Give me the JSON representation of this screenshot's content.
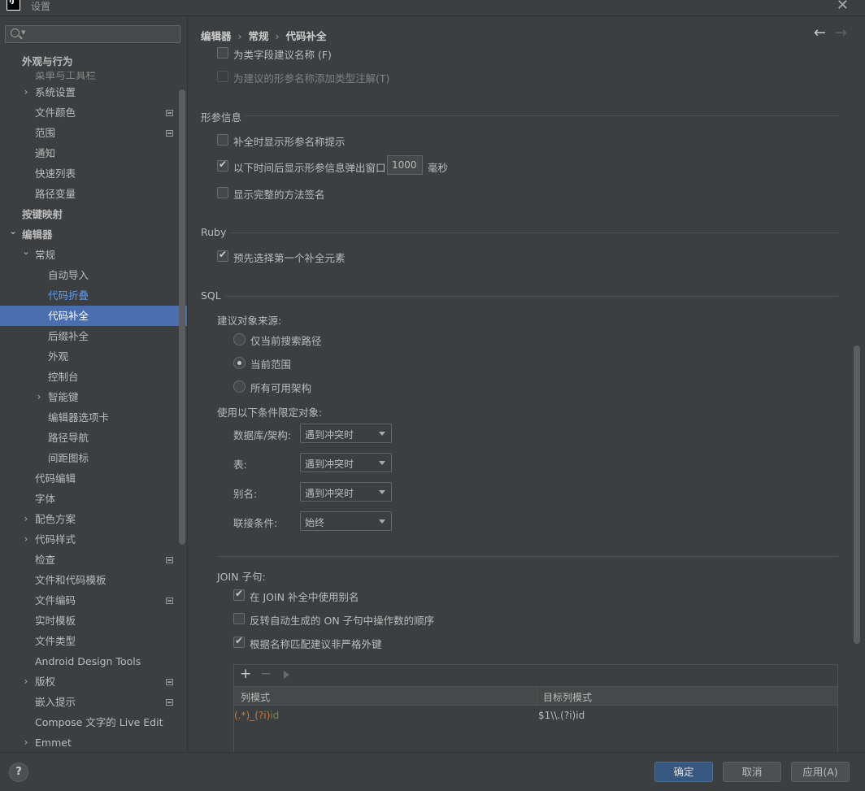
{
  "window": {
    "title": "设置",
    "app_icon": "IJ"
  },
  "search": {
    "placeholder": ""
  },
  "sidebar": {
    "items": [
      {
        "label": "外观与行为",
        "level": 0,
        "bold": true
      },
      {
        "label": "菜单与工具栏",
        "level": 1,
        "cut": true
      },
      {
        "label": "系统设置",
        "level": 1,
        "expandable": true
      },
      {
        "label": "文件颜色",
        "level": 1,
        "badge": true
      },
      {
        "label": "范围",
        "level": 1,
        "badge": true
      },
      {
        "label": "通知",
        "level": 1
      },
      {
        "label": "快速列表",
        "level": 1
      },
      {
        "label": "路径变量",
        "level": 1
      },
      {
        "label": "按键映射",
        "level": 0,
        "bold": true
      },
      {
        "label": "编辑器",
        "level": 0,
        "bold": true,
        "expanded": true
      },
      {
        "label": "常规",
        "level": 1,
        "expanded": true
      },
      {
        "label": "自动导入",
        "level": 2
      },
      {
        "label": "代码折叠",
        "level": 2,
        "link": true
      },
      {
        "label": "代码补全",
        "level": 2,
        "selected": true
      },
      {
        "label": "后缀补全",
        "level": 2
      },
      {
        "label": "外观",
        "level": 2
      },
      {
        "label": "控制台",
        "level": 2
      },
      {
        "label": "智能键",
        "level": 2,
        "expandable": true
      },
      {
        "label": "编辑器选项卡",
        "level": 2
      },
      {
        "label": "路径导航",
        "level": 2
      },
      {
        "label": "间距图标",
        "level": 2
      },
      {
        "label": "代码编辑",
        "level": 1
      },
      {
        "label": "字体",
        "level": 1
      },
      {
        "label": "配色方案",
        "level": 1,
        "expandable": true
      },
      {
        "label": "代码样式",
        "level": 1,
        "expandable": true
      },
      {
        "label": "检查",
        "level": 1,
        "badge": true
      },
      {
        "label": "文件和代码模板",
        "level": 1
      },
      {
        "label": "文件编码",
        "level": 1,
        "badge": true
      },
      {
        "label": "实时模板",
        "level": 1
      },
      {
        "label": "文件类型",
        "level": 1
      },
      {
        "label": "Android Design Tools",
        "level": 1
      },
      {
        "label": "版权",
        "level": 1,
        "expandable": true,
        "badge": true
      },
      {
        "label": "嵌入提示",
        "level": 1,
        "badge": true
      },
      {
        "label": "Compose 文字的 Live Edit",
        "level": 1
      },
      {
        "label": "Emmet",
        "level": 1,
        "expandable": true
      }
    ]
  },
  "breadcrumb": {
    "a": "编辑器",
    "b": "常规",
    "c": "代码补全",
    "sep": "›"
  },
  "nav": {
    "back": "←",
    "forward": "→"
  },
  "top_options": {
    "field_names": "为类字段建议名称 (F)",
    "param_types": "为建议的形参名称添加类型注解(T)"
  },
  "param_info": {
    "title": "形参信息",
    "show_hints": "补全时显示形参名称提示",
    "popup_label": "以下时间后显示形参信息弹出窗口:",
    "popup_value": "1000",
    "popup_unit": "毫秒",
    "full_signature": "显示完整的方法签名"
  },
  "ruby": {
    "title": "Ruby",
    "preselect": "预先选择第一个补全元素"
  },
  "sql": {
    "title": "SQL",
    "source_label": "建议对象来源:",
    "radio_search_path": "仅当前搜索路径",
    "radio_current_scope": "当前范围",
    "radio_all_schemas": "所有可用架构",
    "qualify_label": "使用以下条件限定对象:",
    "rows": [
      {
        "label": "数据库/架构:",
        "value": "遇到冲突时"
      },
      {
        "label": "表:",
        "value": "遇到冲突时"
      },
      {
        "label": "别名:",
        "value": "遇到冲突时"
      },
      {
        "label": "联接条件:",
        "value": "始终"
      }
    ],
    "join_title": "JOIN 子句:",
    "join_alias": "在 JOIN 补全中使用别名",
    "join_reverse": "反转自动生成的 ON 子句中操作数的顺序",
    "join_fk": "根据名称匹配建议非严格外键",
    "table": {
      "add": "+",
      "remove": "−",
      "col_pattern": "列模式",
      "target_pattern": "目标列模式",
      "row_pattern_a": "(.*)_",
      "row_pattern_b": "(?i)",
      "row_pattern_c": "id",
      "row_target": "$1\\\\.(?i)id"
    }
  },
  "footer": {
    "help": "?",
    "ok": "确定",
    "cancel": "取消",
    "apply": "应用(A)"
  },
  "colors": {
    "background": "#3c3f41",
    "selection": "#4b6eaf",
    "link": "#589df6",
    "primary_button": "#365880",
    "regex_orange": "#cc7832",
    "regex_green": "#6a8759"
  }
}
